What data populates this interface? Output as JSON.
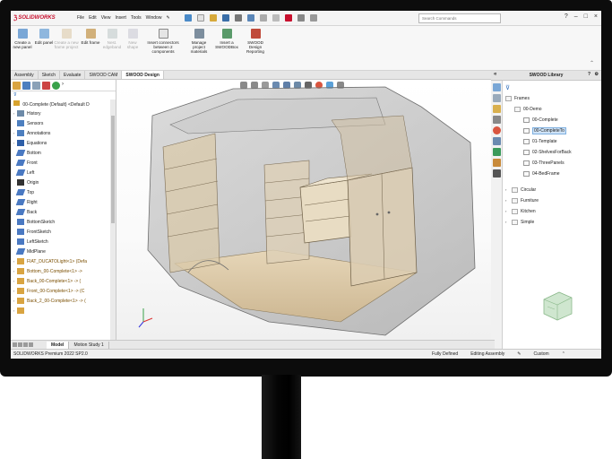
{
  "app": {
    "brand": "SOLIDWORKS",
    "menu": [
      "File",
      "Edit",
      "View",
      "Insert",
      "Tools",
      "Window"
    ],
    "search_placeholder": "Search Commands",
    "window_controls": [
      "?",
      "–",
      "□",
      "×"
    ]
  },
  "ribbon": {
    "buttons": [
      {
        "label": "Create a new panel",
        "dim": false
      },
      {
        "label": "Edit panel",
        "dim": false
      },
      {
        "label": "Create a new frame project",
        "dim": true
      },
      {
        "label": "Edit frame",
        "dim": false
      },
      {
        "label": "Nest. edgeband",
        "dim": true
      },
      {
        "label": "New shape",
        "dim": true
      },
      {
        "label": "Insert connectors between 2 components",
        "dim": false
      },
      {
        "label": "Manage project materials",
        "dim": false
      },
      {
        "label": "Insert a SWOODBox",
        "dim": false
      },
      {
        "label": "SWOOD Design Reporting",
        "dim": false
      }
    ]
  },
  "tabs": [
    "Assembly",
    "Sketch",
    "Evaluate",
    "SWOOD CAM",
    "SWOOD Design"
  ],
  "active_tab": "SWOOD Design",
  "feature_manager": {
    "root": "00-Complete (Default) <Default D",
    "items": [
      {
        "label": "History",
        "expandable": true,
        "icon": "history-icon"
      },
      {
        "label": "Sensors",
        "expandable": false,
        "icon": "sensor-icon"
      },
      {
        "label": "Annotations",
        "expandable": true,
        "icon": "annotation-icon"
      },
      {
        "label": "Equations",
        "expandable": true,
        "icon": "equation-icon"
      },
      {
        "label": "Bottom",
        "expandable": false,
        "icon": "plane-icon"
      },
      {
        "label": "Front",
        "expandable": false,
        "icon": "plane-icon"
      },
      {
        "label": "Left",
        "expandable": false,
        "icon": "plane-icon"
      },
      {
        "label": "Origin",
        "expandable": false,
        "icon": "origin-icon"
      },
      {
        "label": "Top",
        "expandable": false,
        "icon": "plane-icon"
      },
      {
        "label": "Right",
        "expandable": false,
        "icon": "plane-icon"
      },
      {
        "label": "Back",
        "expandable": false,
        "icon": "plane-icon"
      },
      {
        "label": "BottomSketch",
        "expandable": false,
        "icon": "sketch-icon"
      },
      {
        "label": "FrontSketch",
        "expandable": false,
        "icon": "sketch-icon"
      },
      {
        "label": "LeftSketch",
        "expandable": false,
        "icon": "sketch-icon"
      },
      {
        "label": "MidPlane",
        "expandable": false,
        "icon": "plane-icon"
      },
      {
        "label": "FIAT_DUCATOLight<1> (Defa",
        "expandable": true,
        "icon": "part-icon"
      },
      {
        "label": "Bottom_00-Complete<1> ->",
        "expandable": true,
        "icon": "part-icon"
      },
      {
        "label": "Back_00-Complete<1> -> (",
        "expandable": true,
        "icon": "part-icon"
      },
      {
        "label": "Front_00-Complete<1> -> (C",
        "expandable": true,
        "icon": "part-icon"
      },
      {
        "label": "Back_2_00-Complete<1> -> (",
        "expandable": true,
        "icon": "part-icon"
      },
      {
        "label": "",
        "expandable": true,
        "icon": "part-icon"
      }
    ]
  },
  "bottom_tabs": [
    "Model",
    "Motion Study 1"
  ],
  "active_bottom_tab": "Model",
  "status": {
    "product": "SOLIDWORKS Premium 2022 SP2.0",
    "fully_defined": "Fully Defined",
    "editing": "Editing Assembly",
    "custom": "Custom"
  },
  "library": {
    "title": "SWOOD Library",
    "root": "Frames",
    "folder": "00-Demo",
    "items": [
      "00-Complete",
      "00-CompleteTo",
      "01-Template",
      "02-ShelvesForBack",
      "03-ThreePanels",
      "04-BedFrame"
    ],
    "selected": "00-CompleteTo",
    "groups": [
      "Circular",
      "Furniture",
      "Kitchen",
      "Simple"
    ]
  },
  "colors": {
    "accent": "#c8102e",
    "selection": "#cfe3f7",
    "model_wood": "#d9c7a8",
    "model_glass": "#9c9c9c"
  }
}
